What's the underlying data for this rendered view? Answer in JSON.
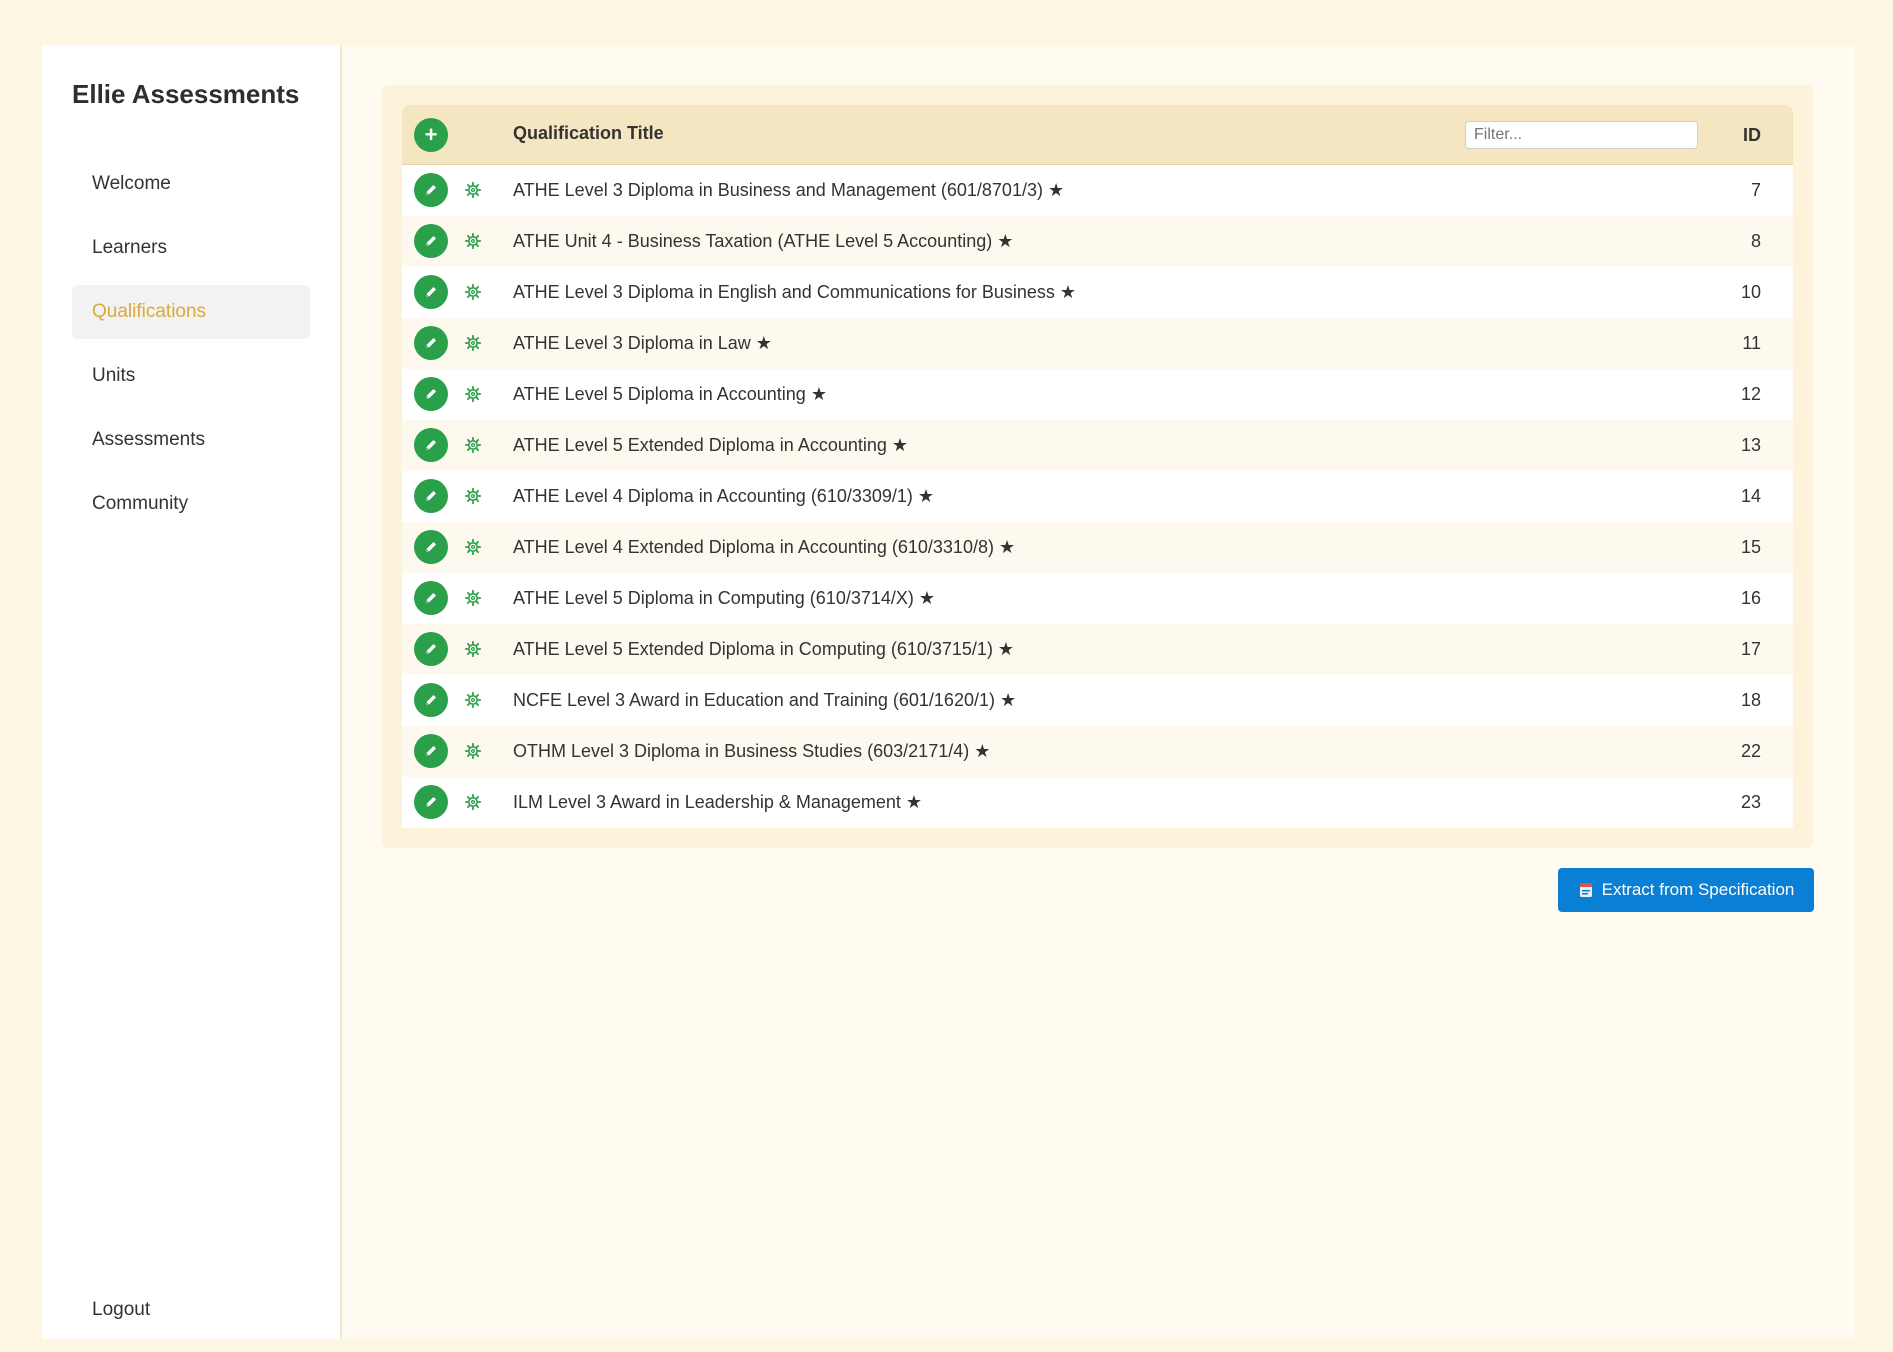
{
  "sidebar": {
    "brand": "Ellie Assessments",
    "items": [
      {
        "label": "Welcome",
        "active": false
      },
      {
        "label": "Learners",
        "active": false
      },
      {
        "label": "Qualifications",
        "active": true
      },
      {
        "label": "Units",
        "active": false
      },
      {
        "label": "Assessments",
        "active": false
      },
      {
        "label": "Community",
        "active": false
      }
    ],
    "logout": "Logout"
  },
  "table": {
    "add_icon": "+",
    "header_title": "Qualification Title",
    "filter_placeholder": "Filter...",
    "header_id": "ID",
    "rows": [
      {
        "title": "ATHE Level 3 Diploma in Business and Management (601/8701/3) ★",
        "id": "7"
      },
      {
        "title": "ATHE Unit 4 - Business Taxation (ATHE Level 5 Accounting) ★",
        "id": "8"
      },
      {
        "title": "ATHE Level 3 Diploma in English and Communications for Business ★",
        "id": "10"
      },
      {
        "title": "ATHE Level 3 Diploma in Law ★",
        "id": "11"
      },
      {
        "title": "ATHE Level 5 Diploma in Accounting ★",
        "id": "12"
      },
      {
        "title": "ATHE Level 5 Extended Diploma in Accounting ★",
        "id": "13"
      },
      {
        "title": "ATHE Level 4 Diploma in Accounting (610/3309/1) ★",
        "id": "14"
      },
      {
        "title": "ATHE Level 4 Extended Diploma in Accounting (610/3310/8) ★",
        "id": "15"
      },
      {
        "title": "ATHE Level 5 Diploma in Computing (610/3714/X) ★",
        "id": "16"
      },
      {
        "title": "ATHE Level 5 Extended Diploma in Computing (610/3715/1) ★",
        "id": "17"
      },
      {
        "title": "NCFE Level 3 Award in Education and Training (601/1620/1) ★",
        "id": "18"
      },
      {
        "title": "OTHM Level 3 Diploma in Business Studies (603/2171/4) ★",
        "id": "22"
      },
      {
        "title": "ILM Level 3 Award in Leadership & Management ★",
        "id": "23"
      }
    ]
  },
  "actions": {
    "extract_label": "Extract from Specification"
  },
  "icons": {
    "add": "plus-icon",
    "edit": "pencil-icon",
    "settings": "gear-icon",
    "extract": "document-icon"
  },
  "colors": {
    "accent_green": "#2aa04a",
    "active_nav": "#d9a93b",
    "primary_button": "#0a7fd6",
    "page_background": "#fdf6e3"
  }
}
